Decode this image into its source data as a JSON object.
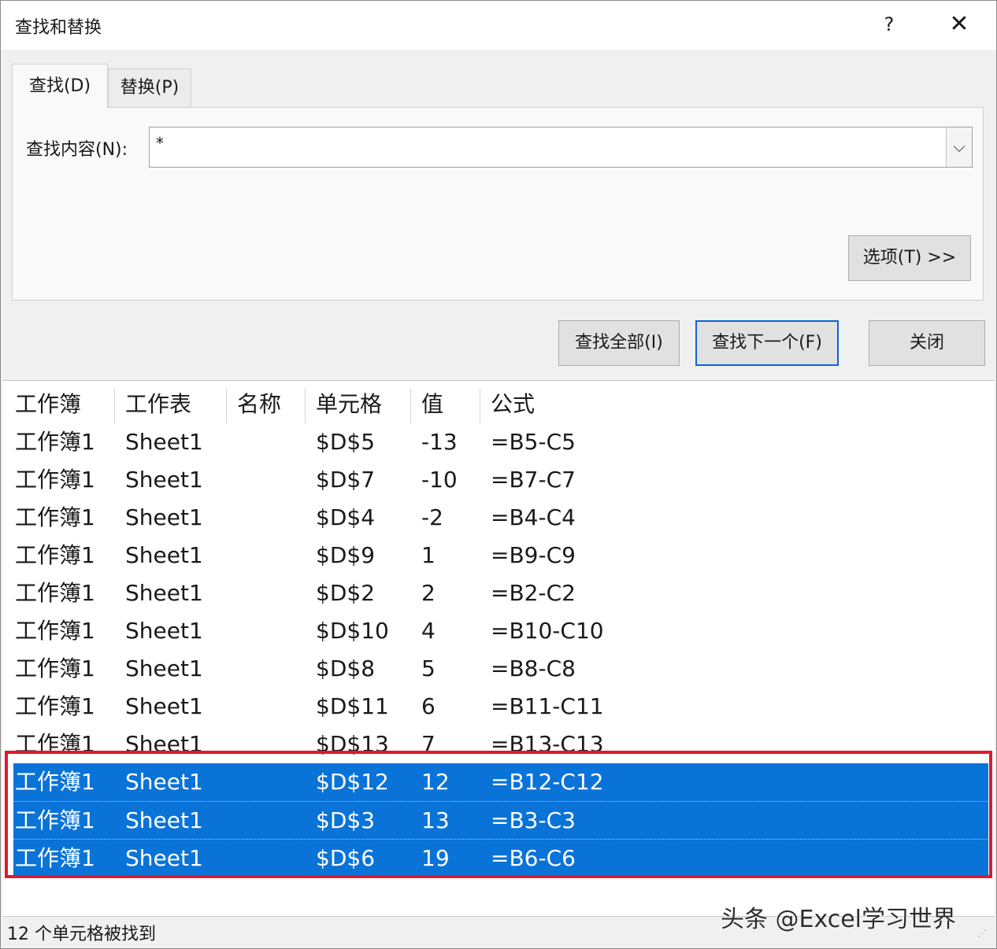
{
  "window": {
    "title": "查找和替换",
    "help": "?",
    "close": "✕"
  },
  "tabs": [
    {
      "label": "查找(D)"
    },
    {
      "label": "替换(P)"
    }
  ],
  "find": {
    "label": "查找内容(N):",
    "value": "*"
  },
  "buttons": {
    "options": "选项(T) >>",
    "find_all": "查找全部(I)",
    "find_next": "查找下一个(F)",
    "close": "关闭"
  },
  "results": {
    "headers": [
      "工作簿",
      "工作表",
      "名称",
      "单元格",
      "值",
      "公式"
    ],
    "rows": [
      {
        "book": "工作簿1",
        "sheet": "Sheet1",
        "cell": "$D$5",
        "value": "-13",
        "formula": "=B5-C5"
      },
      {
        "book": "工作簿1",
        "sheet": "Sheet1",
        "cell": "$D$7",
        "value": "-10",
        "formula": "=B7-C7"
      },
      {
        "book": "工作簿1",
        "sheet": "Sheet1",
        "cell": "$D$4",
        "value": "-2",
        "formula": "=B4-C4"
      },
      {
        "book": "工作簿1",
        "sheet": "Sheet1",
        "cell": "$D$9",
        "value": "1",
        "formula": "=B9-C9"
      },
      {
        "book": "工作簿1",
        "sheet": "Sheet1",
        "cell": "$D$2",
        "value": "2",
        "formula": "=B2-C2"
      },
      {
        "book": "工作簿1",
        "sheet": "Sheet1",
        "cell": "$D$10",
        "value": "4",
        "formula": "=B10-C10"
      },
      {
        "book": "工作簿1",
        "sheet": "Sheet1",
        "cell": "$D$8",
        "value": "5",
        "formula": "=B8-C8"
      },
      {
        "book": "工作簿1",
        "sheet": "Sheet1",
        "cell": "$D$11",
        "value": "6",
        "formula": "=B11-C11"
      },
      {
        "book": "工作簿1",
        "sheet": "Sheet1",
        "cell": "$D$13",
        "value": "7",
        "formula": "=B13-C13"
      },
      {
        "book": "工作簿1",
        "sheet": "Sheet1",
        "cell": "$D$12",
        "value": "12",
        "formula": "=B12-C12"
      },
      {
        "book": "工作簿1",
        "sheet": "Sheet1",
        "cell": "$D$3",
        "value": "13",
        "formula": "=B3-C3"
      },
      {
        "book": "工作簿1",
        "sheet": "Sheet1",
        "cell": "$D$6",
        "value": "19",
        "formula": "=B6-C6"
      }
    ]
  },
  "status": "12 个单元格被找到",
  "watermark": "头条 @Excel学习世界",
  "colors": {
    "selection": "#0a73d8",
    "highlight_border": "#e0192a",
    "focus_border": "#0a64d8"
  }
}
